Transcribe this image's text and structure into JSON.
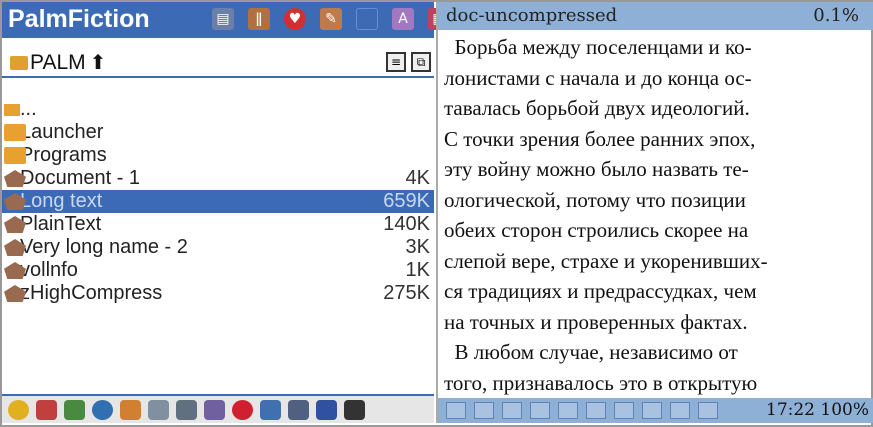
{
  "app_title": "PalmFiction",
  "path": {
    "label": "PALM"
  },
  "files": [
    {
      "name": "...",
      "size": "",
      "type": "parent"
    },
    {
      "name": "Launcher",
      "size": "",
      "type": "folder"
    },
    {
      "name": "Programs",
      "size": "",
      "type": "folder"
    },
    {
      "name": "Document - 1",
      "size": "4K",
      "type": "doc"
    },
    {
      "name": "Long text",
      "size": "659K",
      "type": "doc",
      "selected": true
    },
    {
      "name": "PlainText",
      "size": "140K",
      "type": "doc"
    },
    {
      "name": "Very long name - 2",
      "size": "3K",
      "type": "doc"
    },
    {
      "name": "vollnfo",
      "size": "1K",
      "type": "doc"
    },
    {
      "name": "zHighCompress",
      "size": "275K",
      "type": "doc"
    }
  ],
  "reader": {
    "doc_name": "doc-uncompressed",
    "progress": "0.1%",
    "lines": [
      "  Борьба между поселенцами и ко-",
      "лонистами с начала и до конца ос-",
      "тавалась борьбой двух идеологий.",
      "С точки зрения более ранних эпох,",
      "эту войну можно было назвать те-",
      "ологической, потому что позиции",
      "обеих сторон строились скорее на",
      "слепой вере, страхе и укоренивших-",
      "ся традициях и предрассудках, чем",
      "на точных и проверенных фактах.",
      "  В любом случае, независимо от",
      "того, признавалось это в открытую"
    ],
    "status_time": "17:22 100%"
  }
}
